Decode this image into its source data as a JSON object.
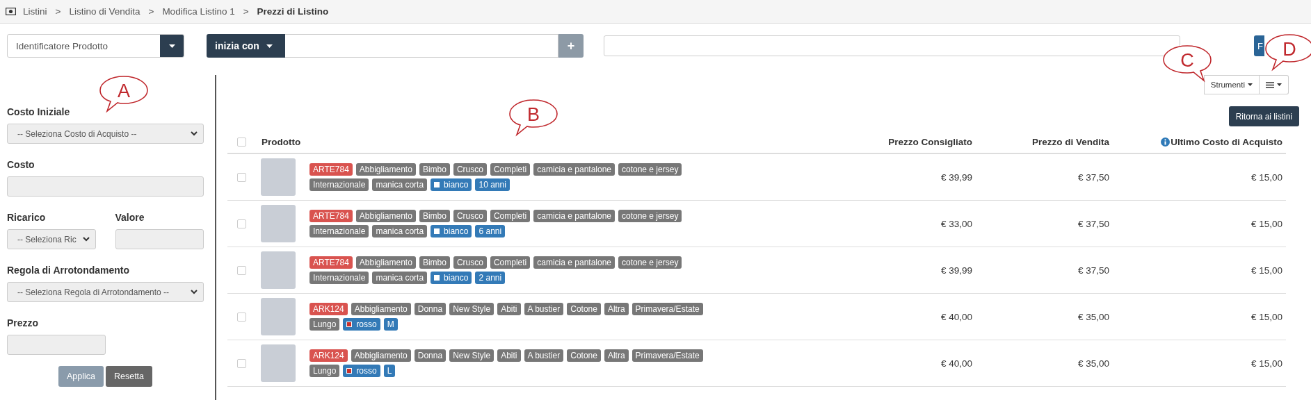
{
  "breadcrumb": {
    "separator": ">",
    "items": [
      {
        "label": "Listini",
        "current": false
      },
      {
        "label": "Listino di Vendita",
        "current": false
      },
      {
        "label": "Modifica Listino 1",
        "current": false
      },
      {
        "label": "Prezzi di Listino",
        "current": true
      }
    ]
  },
  "filter_bar": {
    "field_select": "Identificatore Prodotto",
    "operator": "inizia con",
    "add_button": "+",
    "search_button": "F"
  },
  "toolbar": {
    "tools_button": "Strumenti",
    "back_button": "Ritorna ai listini"
  },
  "form": {
    "rows": [
      [
        {
          "label": "Costo Iniziale",
          "kind": "select",
          "value": "-- Seleziona Costo di Acquisto --"
        }
      ],
      [
        {
          "label": "Costo",
          "kind": "input"
        }
      ],
      [
        {
          "label": "Ricarico",
          "kind": "select",
          "value": "-- Seleziona Ric"
        },
        {
          "label": "Valore",
          "kind": "input"
        }
      ],
      [
        {
          "label": "Regola di Arrotondamento",
          "kind": "select",
          "value": "-- Seleziona Regola di Arrotondamento --"
        }
      ],
      [
        {
          "label": "Prezzo",
          "kind": "input"
        }
      ]
    ],
    "buttons": [
      {
        "label": "Applica",
        "disabled": true
      },
      {
        "label": "Resetta",
        "disabled": false
      }
    ]
  },
  "table": {
    "header_checked": false,
    "columns": [
      "Prodotto",
      "Prezzo Consigliato",
      "Prezzo di Vendita",
      "Ultimo Costo di Acquisto"
    ],
    "rows": [
      {
        "selected": false,
        "tags": [
          [
            {
              "kind": "code",
              "text": "ARTE784"
            },
            {
              "kind": "attribute",
              "text": "Abbigliamento"
            },
            {
              "kind": "attribute",
              "text": "Bimbo"
            },
            {
              "kind": "attribute",
              "text": "Crusco"
            },
            {
              "kind": "attribute",
              "text": "Completi"
            },
            {
              "kind": "attribute",
              "text": "camicia e pantalone"
            },
            {
              "kind": "attribute",
              "text": "cotone e jersey"
            }
          ],
          [
            {
              "kind": "attribute",
              "text": "Internazionale"
            },
            {
              "kind": "attribute",
              "text": "manica corta"
            },
            {
              "kind": "color",
              "text": "bianco",
              "color": "#ffffff"
            },
            {
              "kind": "size",
              "text": "10 anni"
            }
          ]
        ],
        "prezzo_consigliato": "€ 39,99",
        "prezzo_vendita": "€ 37,50",
        "ultimo_costo": "€ 15,00"
      },
      {
        "selected": false,
        "tags": [
          [
            {
              "kind": "code",
              "text": "ARTE784"
            },
            {
              "kind": "attribute",
              "text": "Abbigliamento"
            },
            {
              "kind": "attribute",
              "text": "Bimbo"
            },
            {
              "kind": "attribute",
              "text": "Crusco"
            },
            {
              "kind": "attribute",
              "text": "Completi"
            },
            {
              "kind": "attribute",
              "text": "camicia e pantalone"
            },
            {
              "kind": "attribute",
              "text": "cotone e jersey"
            }
          ],
          [
            {
              "kind": "attribute",
              "text": "Internazionale"
            },
            {
              "kind": "attribute",
              "text": "manica corta"
            },
            {
              "kind": "color",
              "text": "bianco",
              "color": "#ffffff"
            },
            {
              "kind": "size",
              "text": "6 anni"
            }
          ]
        ],
        "prezzo_consigliato": "€ 33,00",
        "prezzo_vendita": "€ 37,50",
        "ultimo_costo": "€ 15,00"
      },
      {
        "selected": false,
        "tags": [
          [
            {
              "kind": "code",
              "text": "ARTE784"
            },
            {
              "kind": "attribute",
              "text": "Abbigliamento"
            },
            {
              "kind": "attribute",
              "text": "Bimbo"
            },
            {
              "kind": "attribute",
              "text": "Crusco"
            },
            {
              "kind": "attribute",
              "text": "Completi"
            },
            {
              "kind": "attribute",
              "text": "camicia e pantalone"
            },
            {
              "kind": "attribute",
              "text": "cotone e jersey"
            }
          ],
          [
            {
              "kind": "attribute",
              "text": "Internazionale"
            },
            {
              "kind": "attribute",
              "text": "manica corta"
            },
            {
              "kind": "color",
              "text": "bianco",
              "color": "#ffffff"
            },
            {
              "kind": "size",
              "text": "2 anni"
            }
          ]
        ],
        "prezzo_consigliato": "€ 39,99",
        "prezzo_vendita": "€ 37,50",
        "ultimo_costo": "€ 15,00"
      },
      {
        "selected": false,
        "tags": [
          [
            {
              "kind": "code",
              "text": "ARK124"
            },
            {
              "kind": "attribute",
              "text": "Abbigliamento"
            },
            {
              "kind": "attribute",
              "text": "Donna"
            },
            {
              "kind": "attribute",
              "text": "New Style"
            },
            {
              "kind": "attribute",
              "text": "Abiti"
            },
            {
              "kind": "attribute",
              "text": "A bustier"
            },
            {
              "kind": "attribute",
              "text": "Cotone"
            },
            {
              "kind": "attribute",
              "text": "Altra"
            },
            {
              "kind": "attribute",
              "text": "Primavera/Estate"
            }
          ],
          [
            {
              "kind": "attribute",
              "text": "Lungo"
            },
            {
              "kind": "color",
              "text": "rosso",
              "color": "#c9302c"
            },
            {
              "kind": "size",
              "text": "M"
            }
          ]
        ],
        "prezzo_consigliato": "€ 40,00",
        "prezzo_vendita": "€ 35,00",
        "ultimo_costo": "€ 15,00"
      },
      {
        "selected": false,
        "tags": [
          [
            {
              "kind": "code",
              "text": "ARK124"
            },
            {
              "kind": "attribute",
              "text": "Abbigliamento"
            },
            {
              "kind": "attribute",
              "text": "Donna"
            },
            {
              "kind": "attribute",
              "text": "New Style"
            },
            {
              "kind": "attribute",
              "text": "Abiti"
            },
            {
              "kind": "attribute",
              "text": "A bustier"
            },
            {
              "kind": "attribute",
              "text": "Cotone"
            },
            {
              "kind": "attribute",
              "text": "Altra"
            },
            {
              "kind": "attribute",
              "text": "Primavera/Estate"
            }
          ],
          [
            {
              "kind": "attribute",
              "text": "Lungo"
            },
            {
              "kind": "color",
              "text": "rosso",
              "color": "#c9302c"
            },
            {
              "kind": "size",
              "text": "L"
            }
          ]
        ],
        "prezzo_consigliato": "€ 40,00",
        "prezzo_vendita": "€ 35,00",
        "ultimo_costo": "€ 15,00"
      }
    ]
  },
  "callouts": [
    {
      "label": "A",
      "kind": "left"
    },
    {
      "label": "B",
      "kind": "left"
    },
    {
      "label": "C",
      "kind": "right"
    },
    {
      "label": "D",
      "kind": "left"
    }
  ]
}
